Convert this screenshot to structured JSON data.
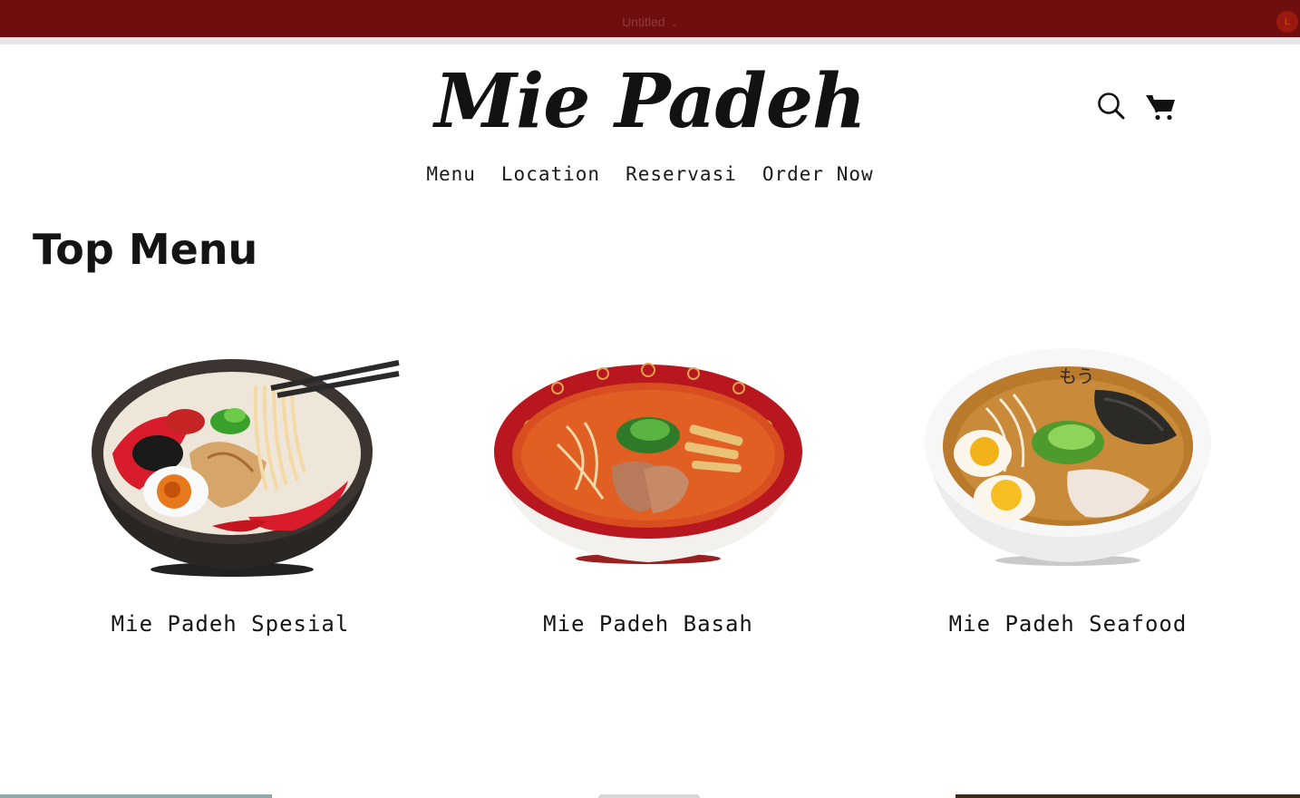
{
  "window": {
    "doc_title": "Untitled",
    "user_initial": "L"
  },
  "site": {
    "logo": "Mie Padeh",
    "nav": [
      {
        "label": "Menu"
      },
      {
        "label": "Location"
      },
      {
        "label": "Reservasi"
      },
      {
        "label": "Order Now"
      }
    ],
    "icons": [
      "search-icon",
      "cart-icon"
    ]
  },
  "main": {
    "section_title": "Top Menu",
    "cards": [
      {
        "label": "Mie Padeh Spesial",
        "image": "ramen-bowl-dark"
      },
      {
        "label": "Mie Padeh Basah",
        "image": "ramen-bowl-red"
      },
      {
        "label": "Mie Padeh Seafood",
        "image": "ramen-bowl-white"
      }
    ]
  },
  "colors": {
    "topbar": "#6e0e0e",
    "text": "#141414",
    "background": "#ffffff"
  }
}
